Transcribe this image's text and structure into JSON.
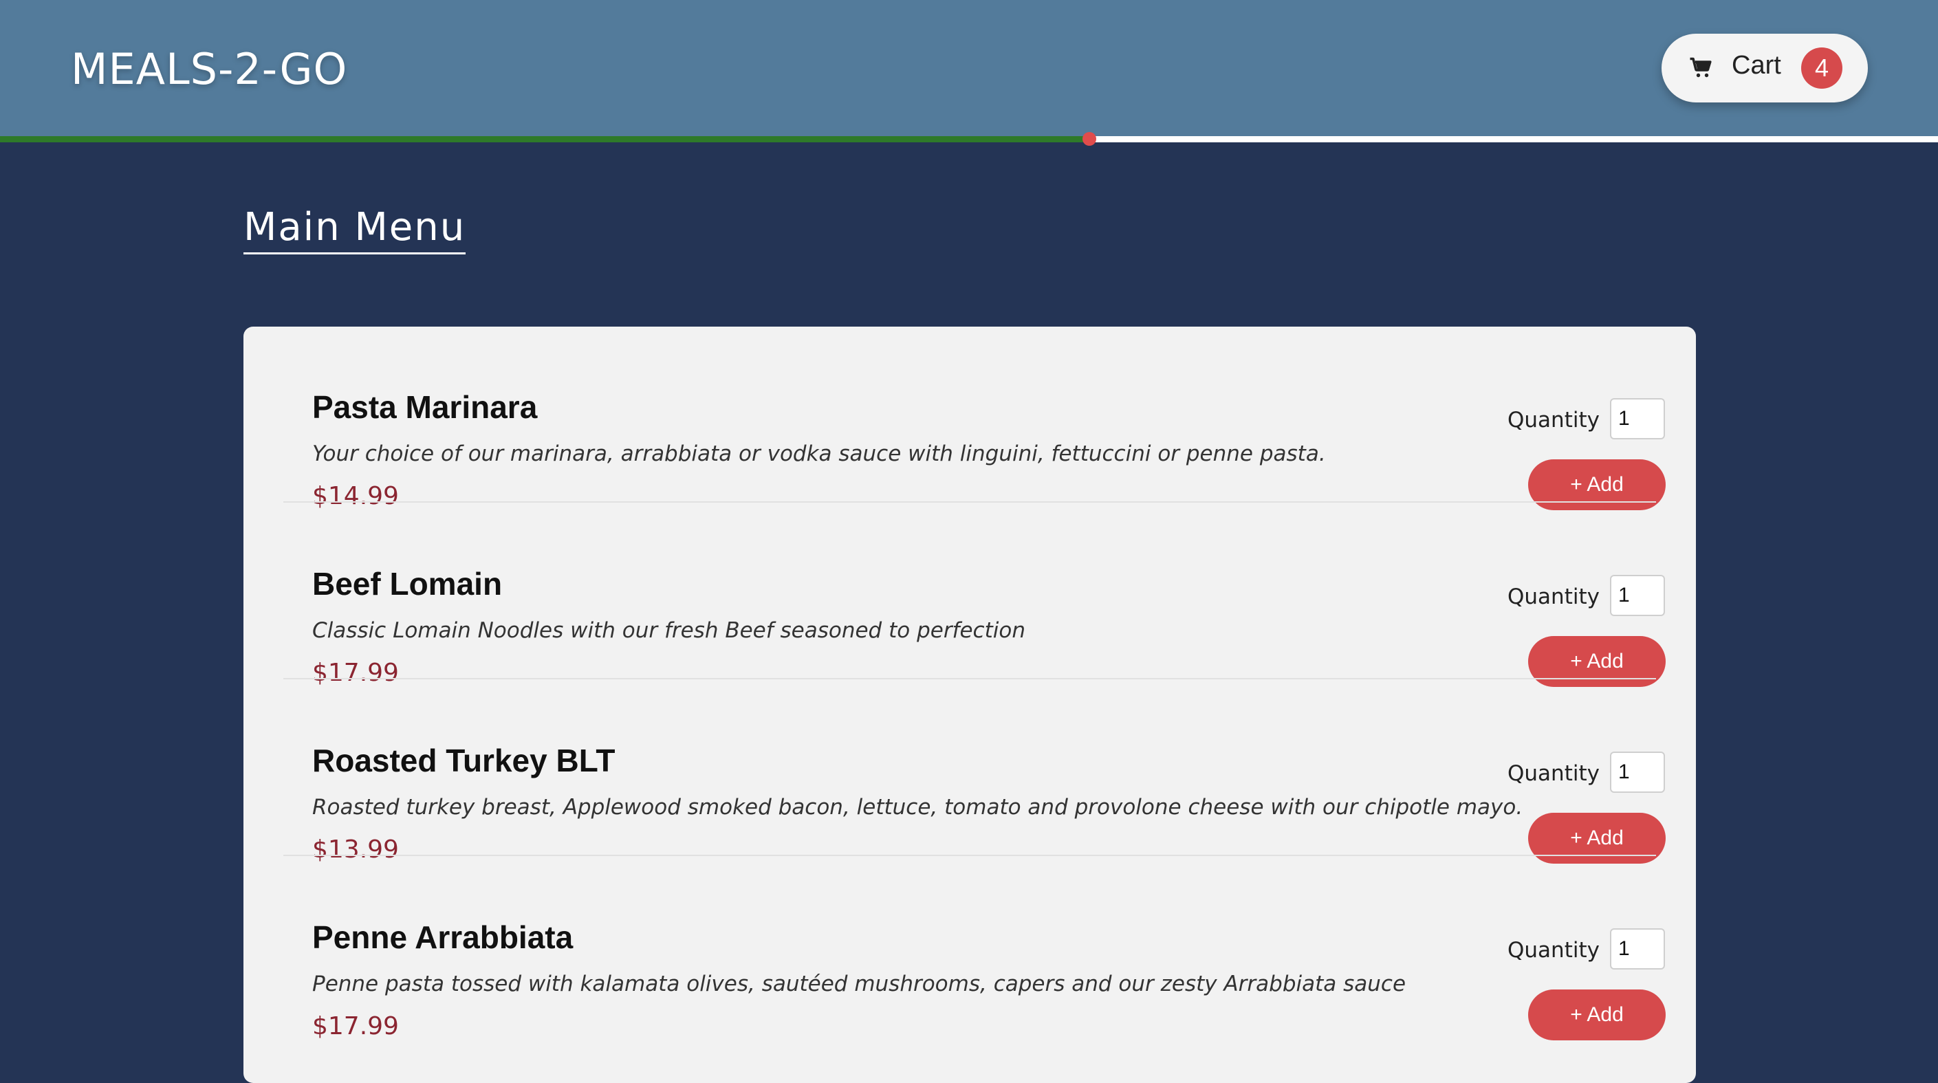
{
  "header": {
    "logo": "MEALS-2-GO",
    "cart_label": "Cart",
    "cart_count": "4"
  },
  "progress": {
    "fraction": 0.562
  },
  "main": {
    "title": "Main Menu"
  },
  "menu_items": [
    {
      "name": "Pasta Marinara",
      "description": "Your choice of our marinara, arrabbiata or vodka sauce with linguini, fettuccini or penne pasta.",
      "price": "$14.99",
      "quantity_label": "Quantity",
      "quantity": "1",
      "add_label": "+ Add"
    },
    {
      "name": "Beef Lomain",
      "description": "Classic Lomain Noodles with our fresh Beef seasoned to perfection",
      "price": "$17.99",
      "quantity_label": "Quantity",
      "quantity": "1",
      "add_label": "+ Add"
    },
    {
      "name": "Roasted Turkey BLT",
      "description": "Roasted turkey breast, Applewood smoked bacon, lettuce, tomato and provolone cheese with our chipotle mayo.",
      "price": "$13.99",
      "quantity_label": "Quantity",
      "quantity": "1",
      "add_label": "+ Add"
    },
    {
      "name": "Penne Arrabbiata",
      "description": "Penne pasta tossed with kalamata olives, sautéed mushrooms, capers and our zesty Arrabbiata sauce",
      "price": "$17.99",
      "quantity_label": "Quantity",
      "quantity": "1",
      "add_label": "+ Add"
    }
  ],
  "icons": {
    "cart": "cart-icon"
  },
  "colors": {
    "header_bg": "#537b9b",
    "page_bg": "#243455",
    "accent": "#d64a4c",
    "price": "#8b2531",
    "progress_fill": "#2e7a2a"
  }
}
